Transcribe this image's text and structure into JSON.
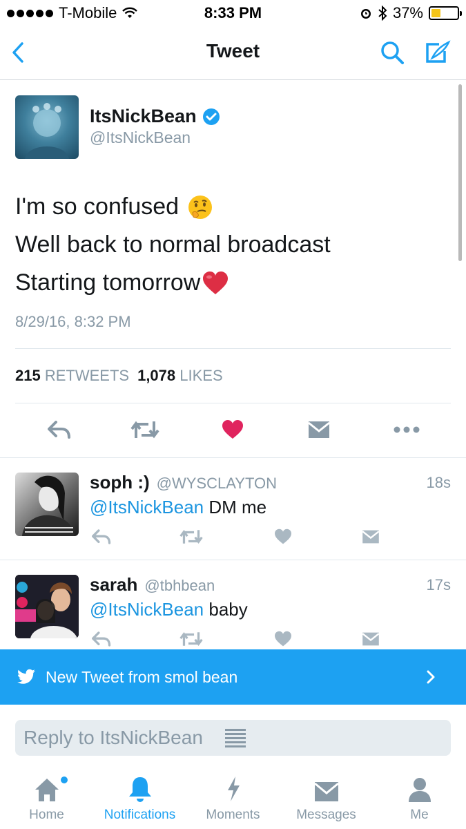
{
  "status_bar": {
    "carrier": "T-Mobile",
    "time": "8:33 PM",
    "battery": "37%",
    "battery_level": 0.37,
    "icons": [
      "signal-dots",
      "wifi-icon",
      "alarm-icon",
      "bluetooth-icon",
      "battery-icon"
    ]
  },
  "nav": {
    "title": "Tweet",
    "back_icon": "chevron-left-icon",
    "search_icon": "search-icon",
    "compose_icon": "compose-icon"
  },
  "tweet": {
    "name": "ItsNickBean",
    "handle": "@ItsNickBean",
    "verified": true,
    "lines": [
      "I'm so confused",
      "Well back to normal broadcast",
      "Starting tomorrow"
    ],
    "emoji": [
      "thinking-face-emoji",
      "red-heart-emoji"
    ],
    "timestamp": "8/29/16, 8:32 PM",
    "retweets_count": "215",
    "retweets_label": "RETWEETS",
    "likes_count": "1,078",
    "likes_label": "LIKES",
    "liked": true
  },
  "replies": [
    {
      "name": "soph :)",
      "handle": "@WYSCLAYTON",
      "time": "18s",
      "mention": "@ItsNickBean",
      "text": "DM me"
    },
    {
      "name": "sarah",
      "handle": "@tbhbean",
      "time": "17s",
      "mention": "@ItsNickBean",
      "text": "baby"
    }
  ],
  "banner": {
    "text": "New Tweet from smol bean",
    "color": "#1da1f2"
  },
  "composer": {
    "placeholder": "Reply to ItsNickBean"
  },
  "tabs": [
    {
      "label": "Home",
      "icon": "home-icon",
      "active": false,
      "badge": true
    },
    {
      "label": "Notifications",
      "icon": "bell-icon",
      "active": true
    },
    {
      "label": "Moments",
      "icon": "lightning-icon",
      "active": false
    },
    {
      "label": "Messages",
      "icon": "envelope-icon",
      "active": false
    },
    {
      "label": "Me",
      "icon": "person-icon",
      "active": false
    }
  ],
  "colors": {
    "accent": "#1da1f2",
    "link": "#1b95e0",
    "muted": "#8899a6",
    "like": "#e0245e"
  }
}
